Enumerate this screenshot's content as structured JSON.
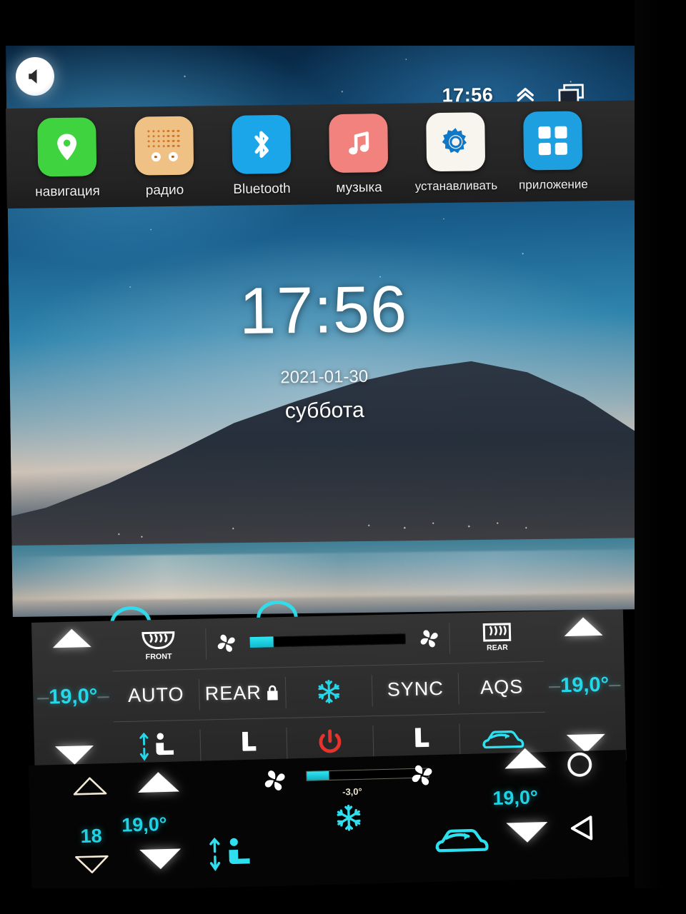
{
  "statusbar": {
    "time": "17:56",
    "expand_icon": "chevron-double-up-icon",
    "recents_icon": "recent-apps-icon",
    "volume_icon": "speaker-icon"
  },
  "dock": {
    "apps": [
      {
        "label": "навигация",
        "icon": "map-pin-icon",
        "tile_color": "#3fd43f"
      },
      {
        "label": "радио",
        "icon": "radio-icon",
        "tile_color": "#f0c184"
      },
      {
        "label": "Bluetooth",
        "icon": "bluetooth-icon",
        "tile_color": "#1aa6e8"
      },
      {
        "label": "музыка",
        "icon": "music-note-icon",
        "tile_color": "#f2827e"
      },
      {
        "label": "устанавливать",
        "icon": "gear-icon",
        "tile_color": "#f7f5ee"
      },
      {
        "label": "приложение",
        "icon": "apps-grid-icon",
        "tile_color": "#1e9fe0"
      }
    ]
  },
  "home": {
    "clock": "17:56",
    "date": "2021-01-30",
    "weekday": "суббота"
  },
  "climate": {
    "left_temp": "19,0°",
    "right_temp": "19,0°",
    "fan_level_percent": 15,
    "buttons": {
      "auto": "AUTO",
      "rear_lock": "REAR",
      "sync": "SYNC",
      "aqs": "AQS"
    },
    "icons": {
      "front_defrost": "front-defrost-icon",
      "front_defrost_label": "FRONT",
      "rear_defrost": "rear-defrost-icon",
      "rear_defrost_label": "REAR",
      "fan_left": "fan-icon",
      "fan_right": "fan-icon",
      "snowflake": "snowflake-icon",
      "seat_face_feet": "airflow-face-feet-icon",
      "seat_feet": "airflow-feet-icon",
      "seat_face": "airflow-face-icon",
      "power": "power-icon",
      "recirculate": "recirculation-icon",
      "temp_up": "triangle-up-icon",
      "temp_down": "triangle-down-icon"
    },
    "accent_cyan": "#25d7e8",
    "power_red": "#e8322c"
  },
  "bottombar": {
    "left_value": "18",
    "left_temp": "19,0°",
    "right_temp": "19,0°",
    "fan_label": "-3,0°",
    "fan_level_percent": 18,
    "icons": {
      "fan_left": "fan-icon",
      "fan_right": "fan-icon",
      "snowflake": "snowflake-icon",
      "recirculate": "recirculation-icon",
      "airflow_face_feet": "airflow-face-feet-icon",
      "nav_home": "home-circle-icon",
      "nav_back": "back-triangle-icon",
      "up_outline": "triangle-up-outline-icon",
      "down_outline": "triangle-down-outline-icon",
      "up_filled": "triangle-up-icon",
      "down_filled": "triangle-down-icon"
    },
    "accent_cyan": "#1fd3e6"
  }
}
